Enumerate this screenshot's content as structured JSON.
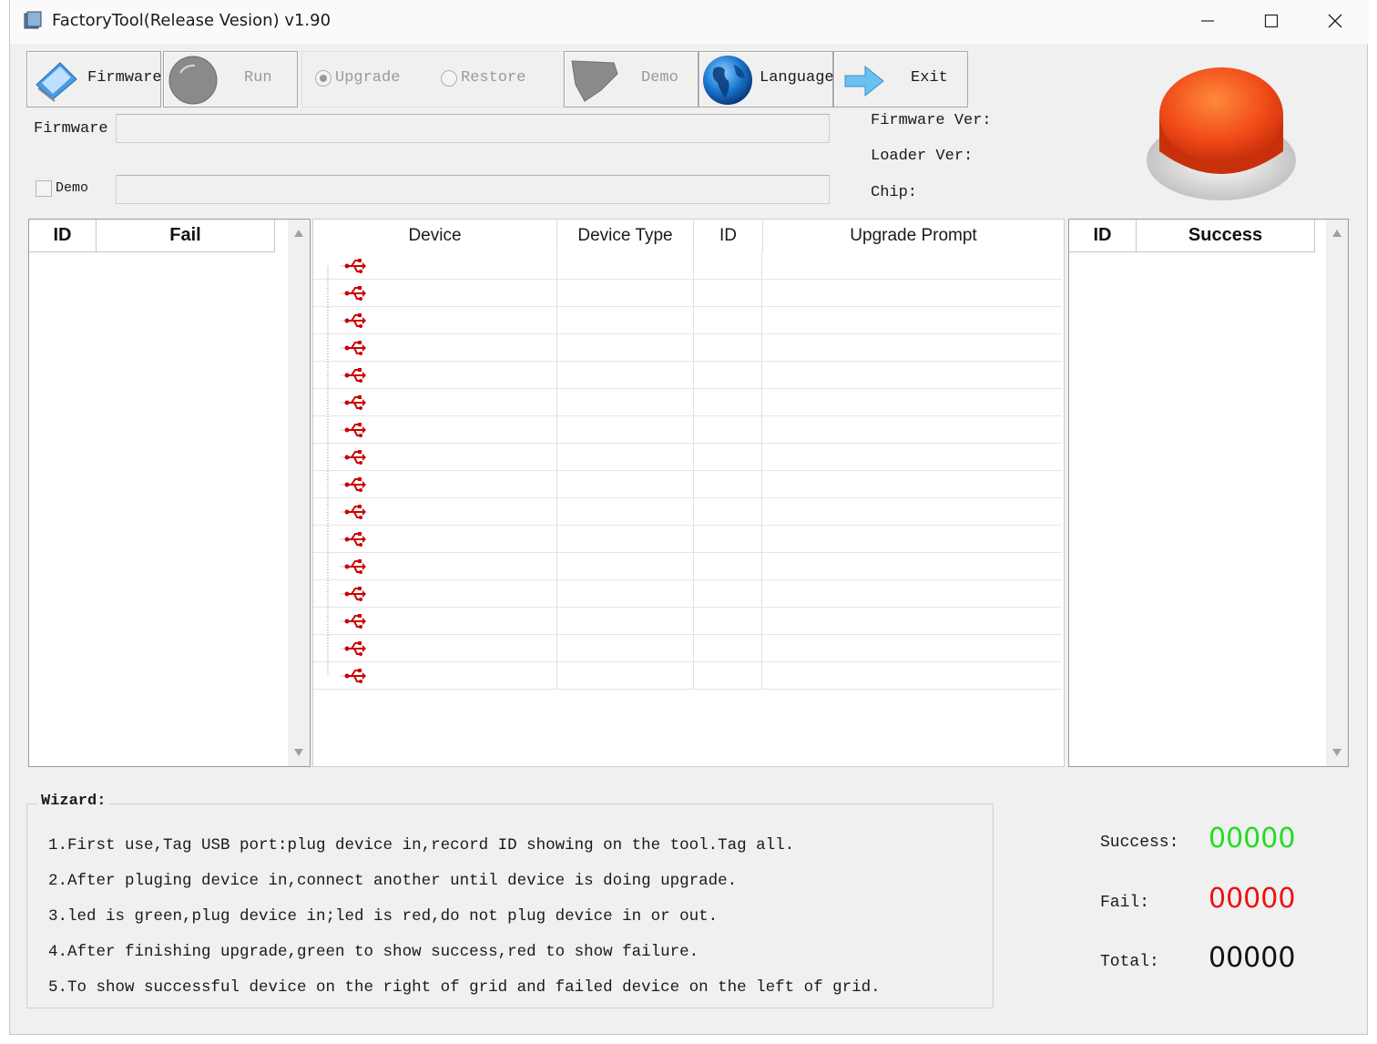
{
  "window": {
    "title": "FactoryTool(Release Vesion) v1.90",
    "controls": [
      "minimize-icon",
      "maximize-icon",
      "close-icon"
    ]
  },
  "toolbar": {
    "firmware_label": "Firmware",
    "run_label": "Run",
    "upgrade_label": "Upgrade",
    "restore_label": "Restore",
    "demo_label": "Demo",
    "language_label": "Language",
    "exit_label": "Exit"
  },
  "fields": {
    "firmware_label": "Firmware",
    "firmware_value": "",
    "demo_label": "Demo",
    "demo_value": "",
    "demo_checked": false
  },
  "info": {
    "firmware_ver": "Firmware Ver:",
    "loader_ver": "Loader Ver:",
    "chip": "Chip:"
  },
  "fail_panel": {
    "id_header": "ID",
    "fail_header": "Fail"
  },
  "success_panel": {
    "id_header": "ID",
    "success_header": "Success"
  },
  "device_grid": {
    "headers": [
      "Device",
      "Device Type",
      "ID",
      "Upgrade Prompt"
    ],
    "row_count_label": "16",
    "row_icon": "usb-icon"
  },
  "wizard": {
    "title": "Wizard:",
    "lines": [
      "1.First use,Tag USB port:plug device in,record ID showing on the tool.Tag all.",
      "2.After pluging device in,connect another until device is doing upgrade.",
      "3.led is green,plug device in;led is red,do not plug device in or out.",
      "4.After finishing upgrade,green to show success,red to show failure.",
      "5.To show successful device on the right of grid and failed device on the left of grid."
    ]
  },
  "stats": {
    "success_label": "Success:",
    "success_value": "00000",
    "fail_label": "Fail:",
    "fail_value": "00000",
    "total_label": "Total:",
    "total_value": "00000"
  },
  "colors": {
    "success": "#22dd22",
    "fail": "#ee1111",
    "total": "#111111",
    "status_button": "#e8401a",
    "usb_icon": "#cc0000"
  }
}
